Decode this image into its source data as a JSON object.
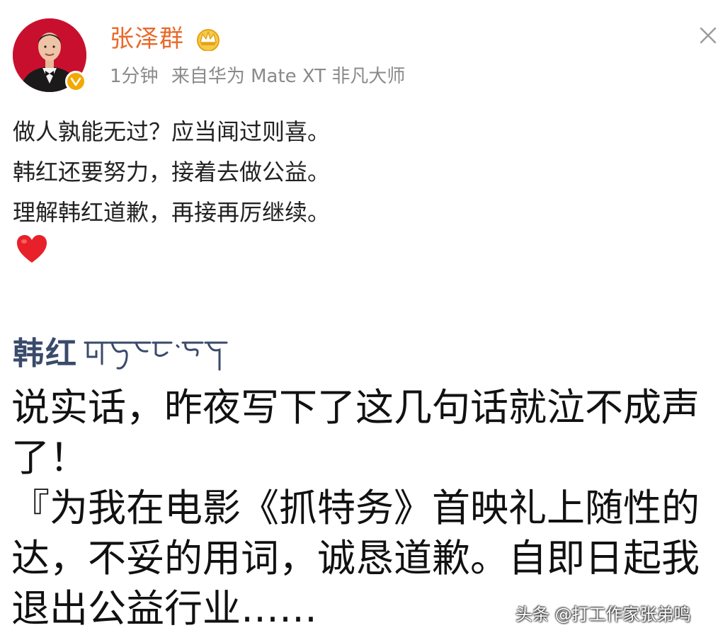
{
  "header": {
    "username": "张泽群",
    "time": "1分钟",
    "source": "来自华为 Mate XT 非凡大师",
    "crown_icon": "crown-icon",
    "verified_icon": "verified-badge-icon",
    "close_icon": "close-icon"
  },
  "post": {
    "lines": [
      "做人孰能无过？应当闻过则喜。",
      "韩红还要努力，接着去做公益。",
      "理解韩红道歉，再接再厉继续。"
    ],
    "emoji": "heart-icon"
  },
  "quoted": {
    "author": "韩红",
    "author_script_icon": "tibetan-script",
    "lines": [
      "说实话，昨夜写下了这几句话就泣不成声",
      "了！",
      "『为我在电影《抓特务》首映礼上随性的",
      "达，不妥的用词，诚恳道歉。自即日起我",
      "退出公益行业……"
    ]
  },
  "watermark": {
    "text": "头条 @打工作家张弟鸣"
  },
  "colors": {
    "username": "#e86a2a",
    "meta": "#8a8a8a",
    "badge": "#f2a900",
    "heart": "#e8202a",
    "quoted_author": "#3a4a6a"
  }
}
